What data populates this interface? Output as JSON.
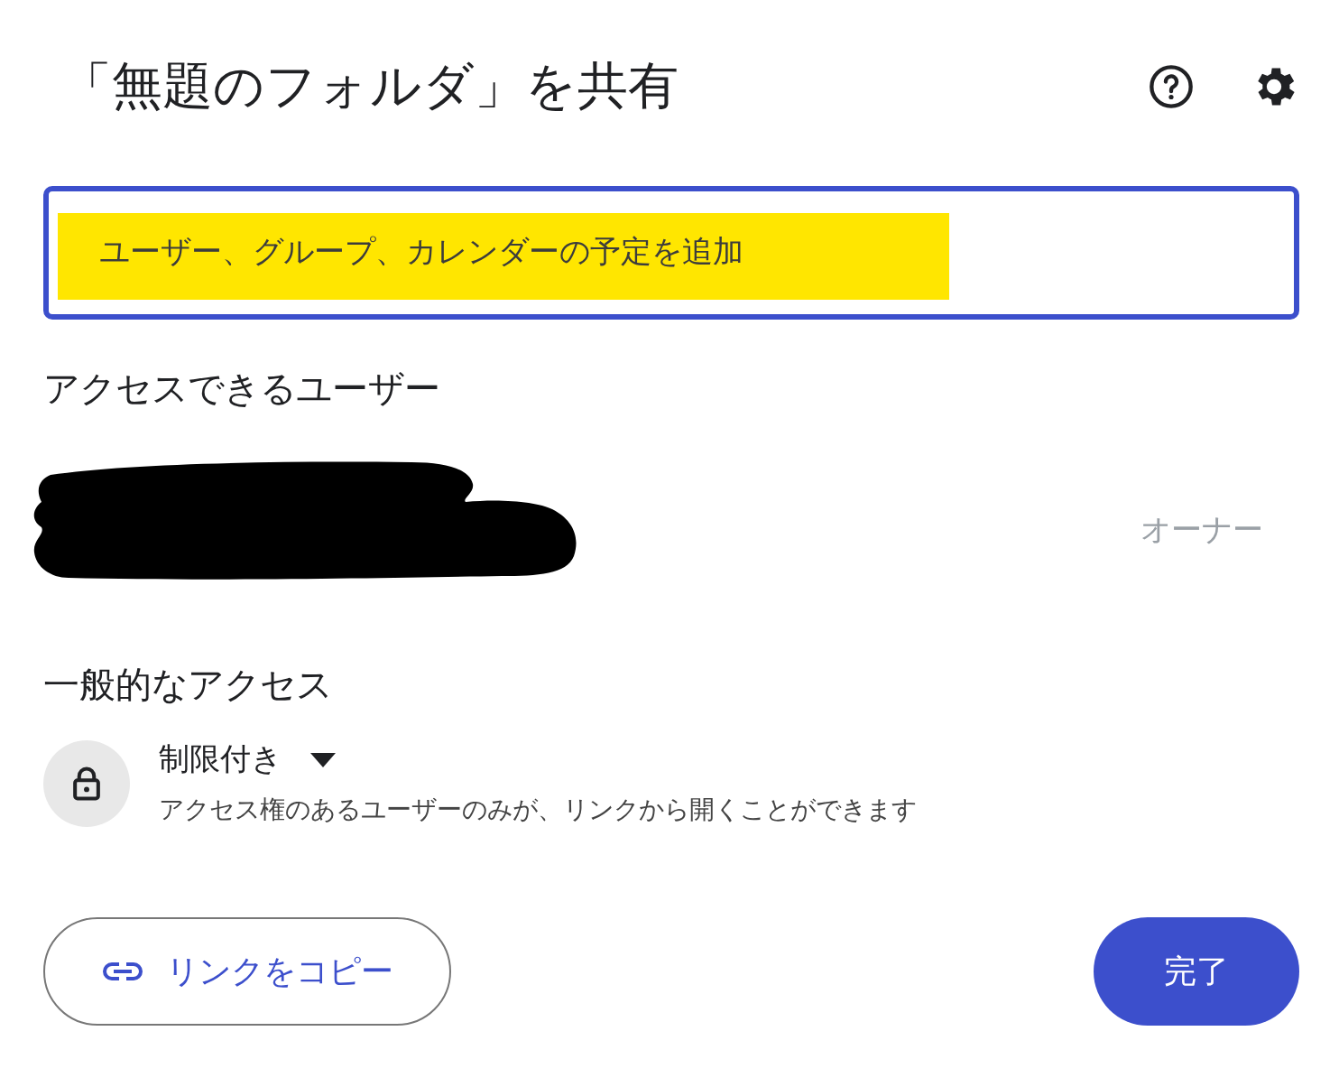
{
  "dialog": {
    "title": "「無題のフォルダ」を共有"
  },
  "add_field": {
    "placeholder": "ユーザー、グループ、カレンダーの予定を追加",
    "highlighted": true
  },
  "people_heading": "アクセスできるユーザー",
  "people": [
    {
      "name_redacted": true,
      "role": "オーナー"
    }
  ],
  "general_access": {
    "heading": "一般的なアクセス",
    "setting": "制限付き",
    "description": "アクセス権のあるユーザーのみが、リンクから開くことができます"
  },
  "buttons": {
    "copy_link": "リンクをコピー",
    "done": "完了"
  }
}
